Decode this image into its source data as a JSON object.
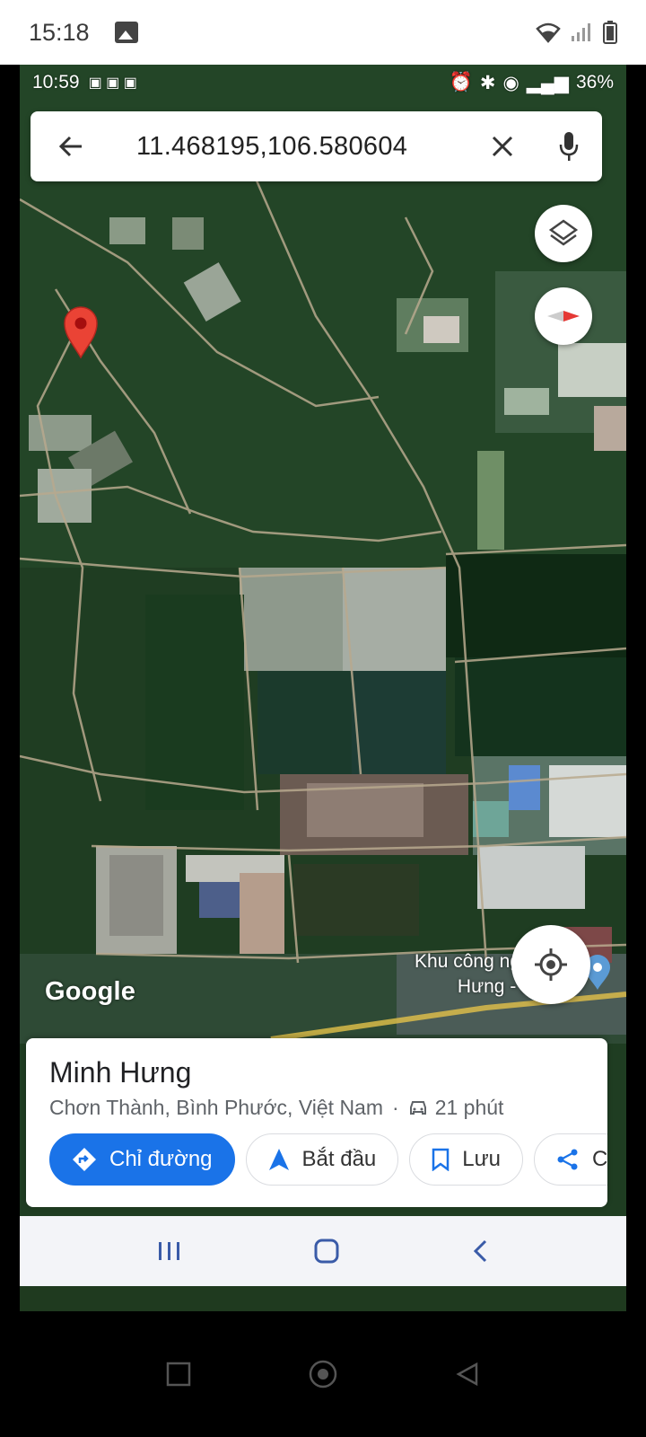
{
  "outer_status": {
    "time": "15:18"
  },
  "inner_status": {
    "time": "10:59",
    "battery": "36%"
  },
  "search": {
    "query": "11.468195,106.580604"
  },
  "map": {
    "logo": "Google",
    "place_label_line1": "Khu công nghiệ",
    "place_label_line2": "Hưng - Hà"
  },
  "place": {
    "name": "Minh Hưng",
    "address": "Chơn Thành, Bình Phước, Việt Nam",
    "separator": "·",
    "drive_time": "21 phút"
  },
  "actions": {
    "directions": "Chỉ đường",
    "start": "Bắt đầu",
    "save": "Lưu",
    "share": "C"
  },
  "colors": {
    "accent": "#1a73e8",
    "pin": "#ea4335"
  },
  "icons": [
    "arrow-left-icon",
    "close-icon",
    "mic-icon",
    "layers-icon",
    "compass-icon",
    "my-location-icon",
    "map-pin-icon",
    "directions-icon",
    "navigation-icon",
    "bookmark-icon",
    "share-icon",
    "car-icon"
  ]
}
